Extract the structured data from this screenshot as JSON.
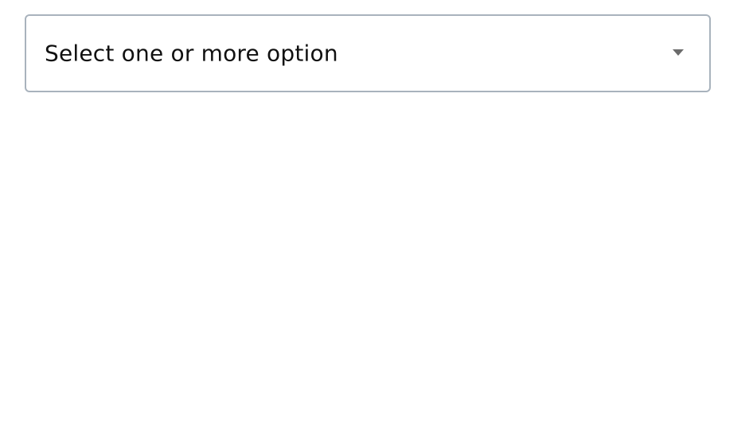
{
  "multiselect": {
    "placeholder": "Select one or more option",
    "icon": "chevron-down-icon",
    "border_color": "#a9b3bd",
    "text_color": "#111111",
    "caret_color": "#6b6b6b"
  }
}
